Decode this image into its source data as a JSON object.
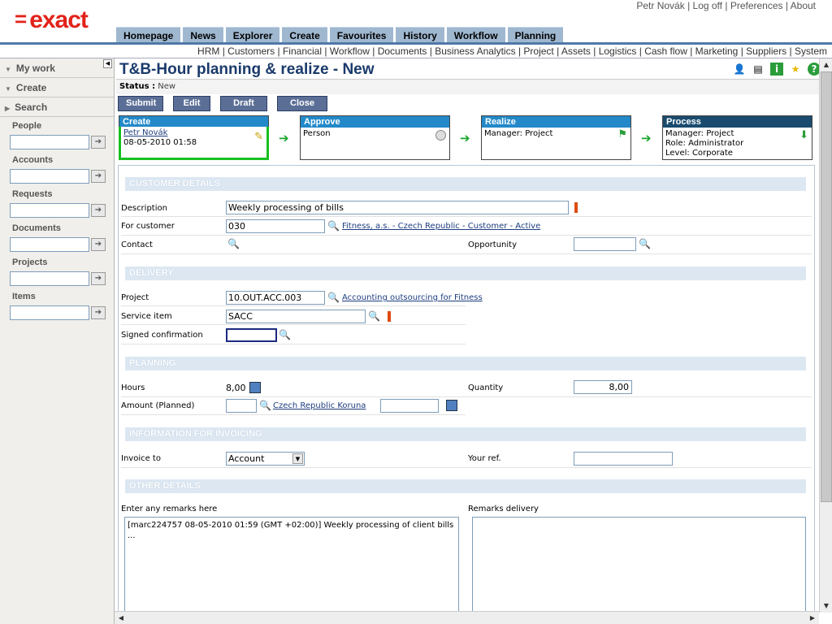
{
  "app": {
    "logo": "exact",
    "logo_mark": "="
  },
  "user": {
    "name": "Petr Novák",
    "logoff": "Log off",
    "preferences": "Preferences",
    "about": "About"
  },
  "main_tabs": [
    "Homepage",
    "News",
    "Explorer",
    "Create",
    "Favourites",
    "History",
    "Workflow",
    "Planning"
  ],
  "sub_links": [
    "HRM",
    "Customers",
    "Financial",
    "Workflow",
    "Documents",
    "Business Analytics",
    "Project",
    "Assets",
    "Logistics",
    "Cash flow",
    "Marketing",
    "Suppliers",
    "System"
  ],
  "sidebar": {
    "my_work": "My work",
    "create": "Create",
    "search": "Search",
    "fields": [
      "People",
      "Accounts",
      "Requests",
      "Documents",
      "Projects",
      "Items"
    ]
  },
  "page": {
    "title": "T&B-Hour planning & realize - New",
    "status_label": "Status :",
    "status_value": "New"
  },
  "actions": {
    "submit": "Submit",
    "edit": "Edit",
    "draft": "Draft",
    "close": "Close"
  },
  "workflow": {
    "create": {
      "title": "Create",
      "person": "Petr Novák",
      "date": "08-05-2010 01:58"
    },
    "approve": {
      "title": "Approve",
      "text": "Person"
    },
    "realize": {
      "title": "Realize",
      "text": "Manager: Project"
    },
    "process": {
      "title": "Process",
      "line1": "Manager: Project",
      "line2": "Role: Administrator",
      "line3": "Level: Corporate"
    }
  },
  "sections": {
    "customer": "CUSTOMER DETAILS",
    "delivery": "DELIVERY",
    "planning": "PLANNING",
    "invoicing": "INFORMATION FOR INVOICING",
    "other": "OTHER DETAILS"
  },
  "fields": {
    "description_label": "Description",
    "description_value": "Weekly processing of bills",
    "customer_label": "For customer",
    "customer_value": "030",
    "customer_link": "Fitness, a.s. - Czech Republic - Customer - Active",
    "contact_label": "Contact",
    "opportunity_label": "Opportunity",
    "project_label": "Project",
    "project_value": "10.OUT.ACC.003",
    "project_link": "Accounting outsourcing for Fitness",
    "service_label": "Service item",
    "service_value": "SACC",
    "signed_label": "Signed confirmation",
    "hours_label": "Hours",
    "hours_value": "8,00",
    "quantity_label": "Quantity",
    "quantity_value": "8,00",
    "amount_label": "Amount (Planned)",
    "currency_link": "Czech Republic Koruna",
    "invoice_label": "Invoice to",
    "invoice_value": "Account",
    "yourref_label": "Your ref.",
    "remarks_label": "Enter any remarks here",
    "remarks_value": "[marc224757 08-05-2010 01:59 (GMT +02:00)] Weekly processing of client bills ...",
    "remarks_delivery_label": "Remarks delivery"
  }
}
